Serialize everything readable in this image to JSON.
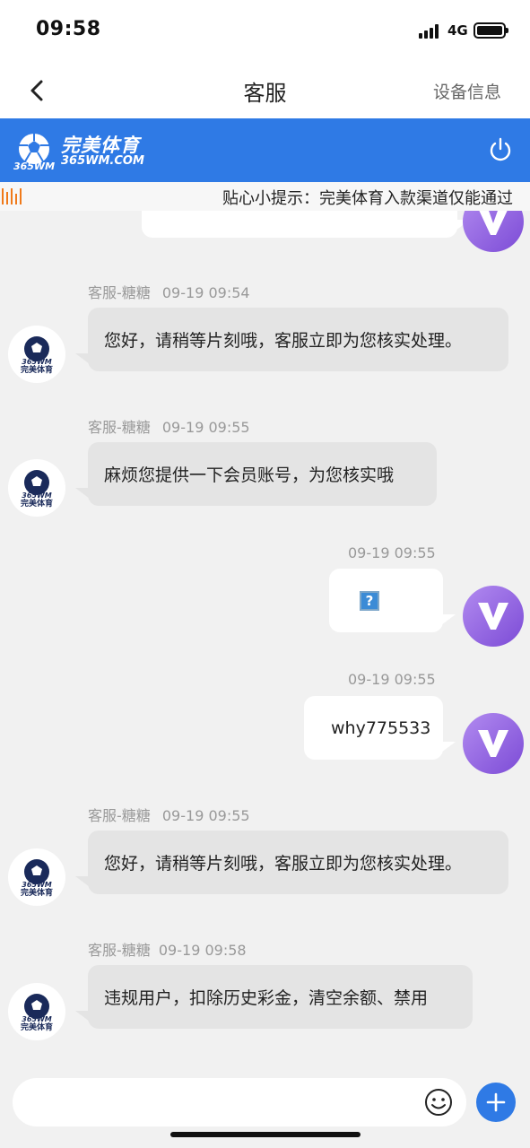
{
  "status_bar": {
    "time": "09:58",
    "network": "4G"
  },
  "nav": {
    "title": "客服",
    "right_action": "设备信息",
    "back_icon": "chevron-left-icon"
  },
  "brand": {
    "name_cn": "完美体育",
    "site": "365WM.COM",
    "color": "#2f7ae5"
  },
  "notice": {
    "text": "贴心小提示：完美体育入款渠道仅能通过"
  },
  "messages": [
    {
      "side": "agent",
      "sender": "客服-糖糖",
      "time": "09-19 09:54",
      "text": "您好，请稍等片刻哦，客服立即为您核实处理。"
    },
    {
      "side": "agent",
      "sender": "客服-糖糖",
      "time": "09-19 09:55",
      "text": "麻烦您提供一下会员账号，为您核实哦"
    },
    {
      "side": "user",
      "time": "09-19 09:55",
      "text": "?"
    },
    {
      "side": "user",
      "time": "09-19 09:55",
      "text": "why775533"
    },
    {
      "side": "agent",
      "sender": "客服-糖糖",
      "time": "09-19 09:55",
      "text": "您好，请稍等片刻哦，客服立即为您核实处理。"
    },
    {
      "side": "agent",
      "sender": "客服-糖糖",
      "time": "09-19 09:58",
      "text": "违规用户，扣除历史彩金，清空余额、禁用"
    }
  ],
  "avatar_label": "完美体育",
  "input": {
    "value": "",
    "placeholder": ""
  },
  "colors": {
    "accent": "#2f7ae5",
    "user_avatar": "#8a5ae0",
    "notice_icon": "#f07a1a"
  }
}
